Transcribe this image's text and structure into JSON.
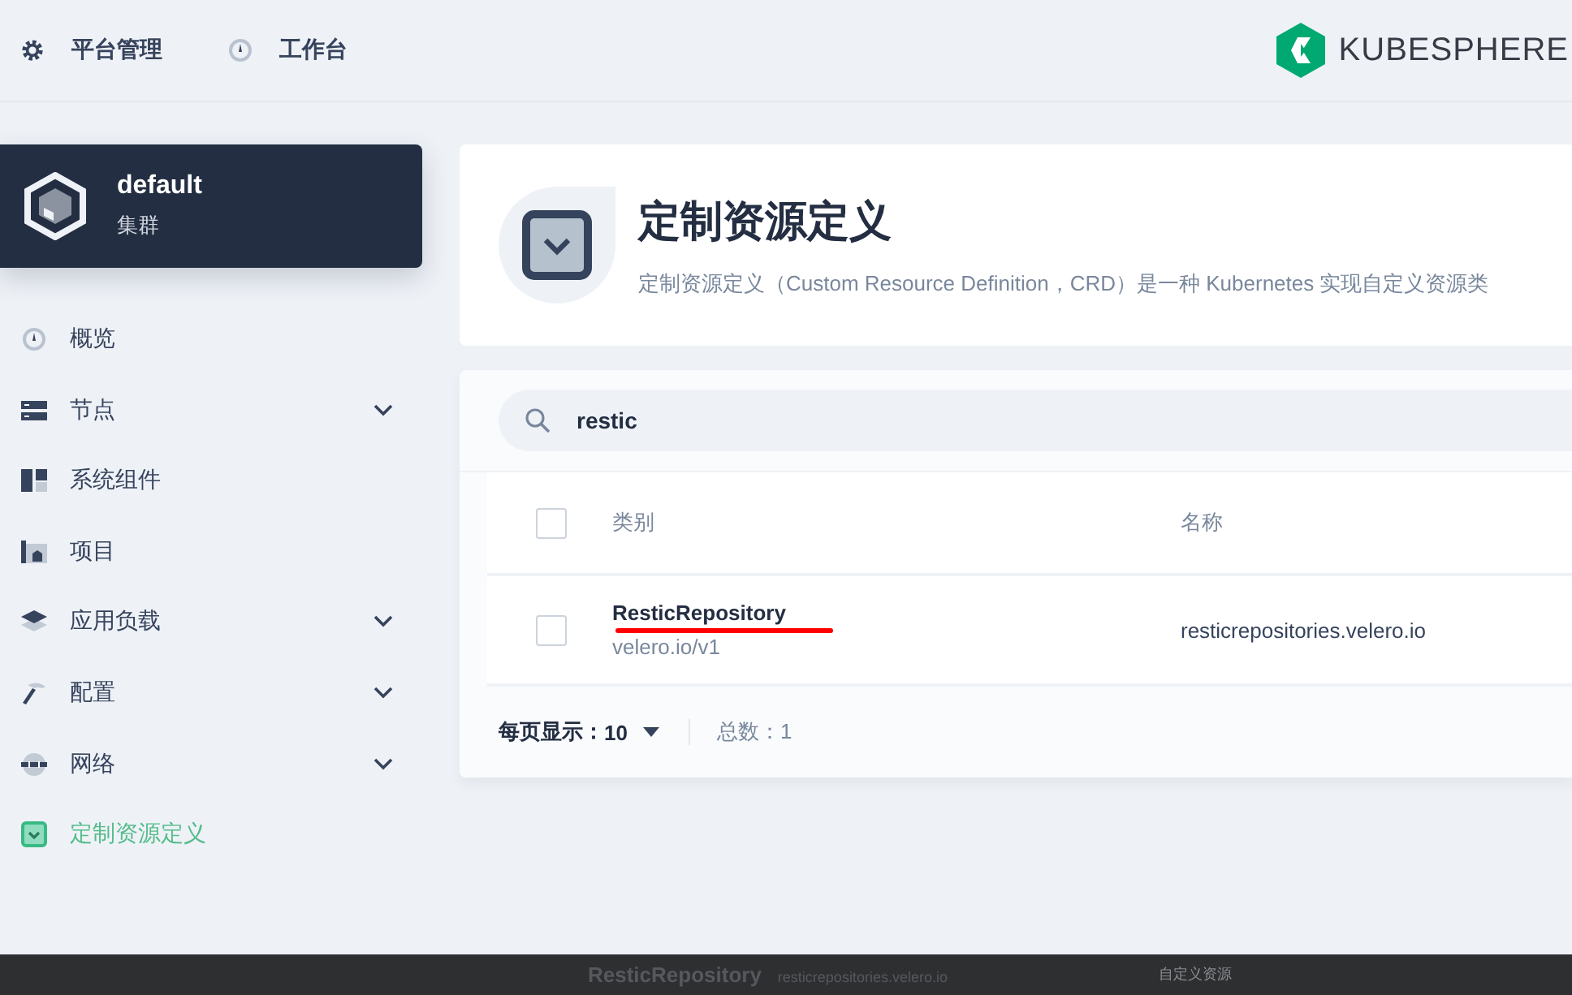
{
  "top_nav": [
    {
      "label": "平台管理"
    },
    {
      "label": "工作台"
    }
  ],
  "logo": {
    "text": "KUBESPHERE"
  },
  "cluster": {
    "name": "default",
    "type": "集群"
  },
  "sidebar": {
    "items": [
      {
        "label": "概览",
        "expandable": false,
        "selected": false
      },
      {
        "label": "节点",
        "expandable": true,
        "selected": false
      },
      {
        "label": "系统组件",
        "expandable": false,
        "selected": false
      },
      {
        "label": "项目",
        "expandable": false,
        "selected": false
      },
      {
        "label": "应用负载",
        "expandable": true,
        "selected": false
      },
      {
        "label": "配置",
        "expandable": true,
        "selected": false
      },
      {
        "label": "网络",
        "expandable": true,
        "selected": false
      },
      {
        "label": "定制资源定义",
        "expandable": false,
        "selected": true
      }
    ]
  },
  "header": {
    "title": "定制资源定义",
    "description": "定制资源定义（Custom Resource Definition，CRD）是一种 Kubernetes 实现自定义资源类"
  },
  "search": {
    "value": "restic"
  },
  "table": {
    "columns": [
      "类别",
      "名称"
    ],
    "rows": [
      {
        "kind": "ResticRepository",
        "group": "velero.io/v1",
        "name": "resticrepositories.velero.io",
        "checked": false
      }
    ],
    "header_checked": false
  },
  "pagination": {
    "per_page_label": "每页显示：",
    "per_page": "10",
    "total": "总数：1"
  },
  "background_page": {
    "title": "ResticRepository",
    "subtitle": "resticrepositories.velero.io",
    "type": "自定义资源"
  }
}
